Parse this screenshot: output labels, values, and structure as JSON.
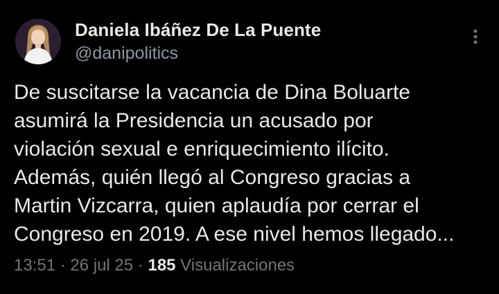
{
  "author": {
    "display_name": "Daniela Ibáñez De La Puente",
    "handle": "@danipolitics"
  },
  "tweet": {
    "lines": [
      "De suscitarse la vacancia de Dina Boluarte",
      "asumirá la Presidencia un acusado por",
      "violación sexual e enriquecimiento ilícito.",
      "Además, quién llegó al Congreso gracias a",
      "Martin Vizcarra, quien aplaudía por cerrar el",
      "Congreso en 2019. A ese nivel hemos llegado..."
    ]
  },
  "meta": {
    "time": "13:51",
    "sep1": " · ",
    "date": "26 jul 25",
    "sep2": " · ",
    "views_count": "185",
    "views_label": " Visualizaciones"
  },
  "icons": {
    "menu": "more-vertical-icon",
    "avatar": "profile-photo"
  },
  "colors": {
    "background": "#000000",
    "primary_text": "#e7e9ea",
    "secondary_text": "#71767b"
  }
}
